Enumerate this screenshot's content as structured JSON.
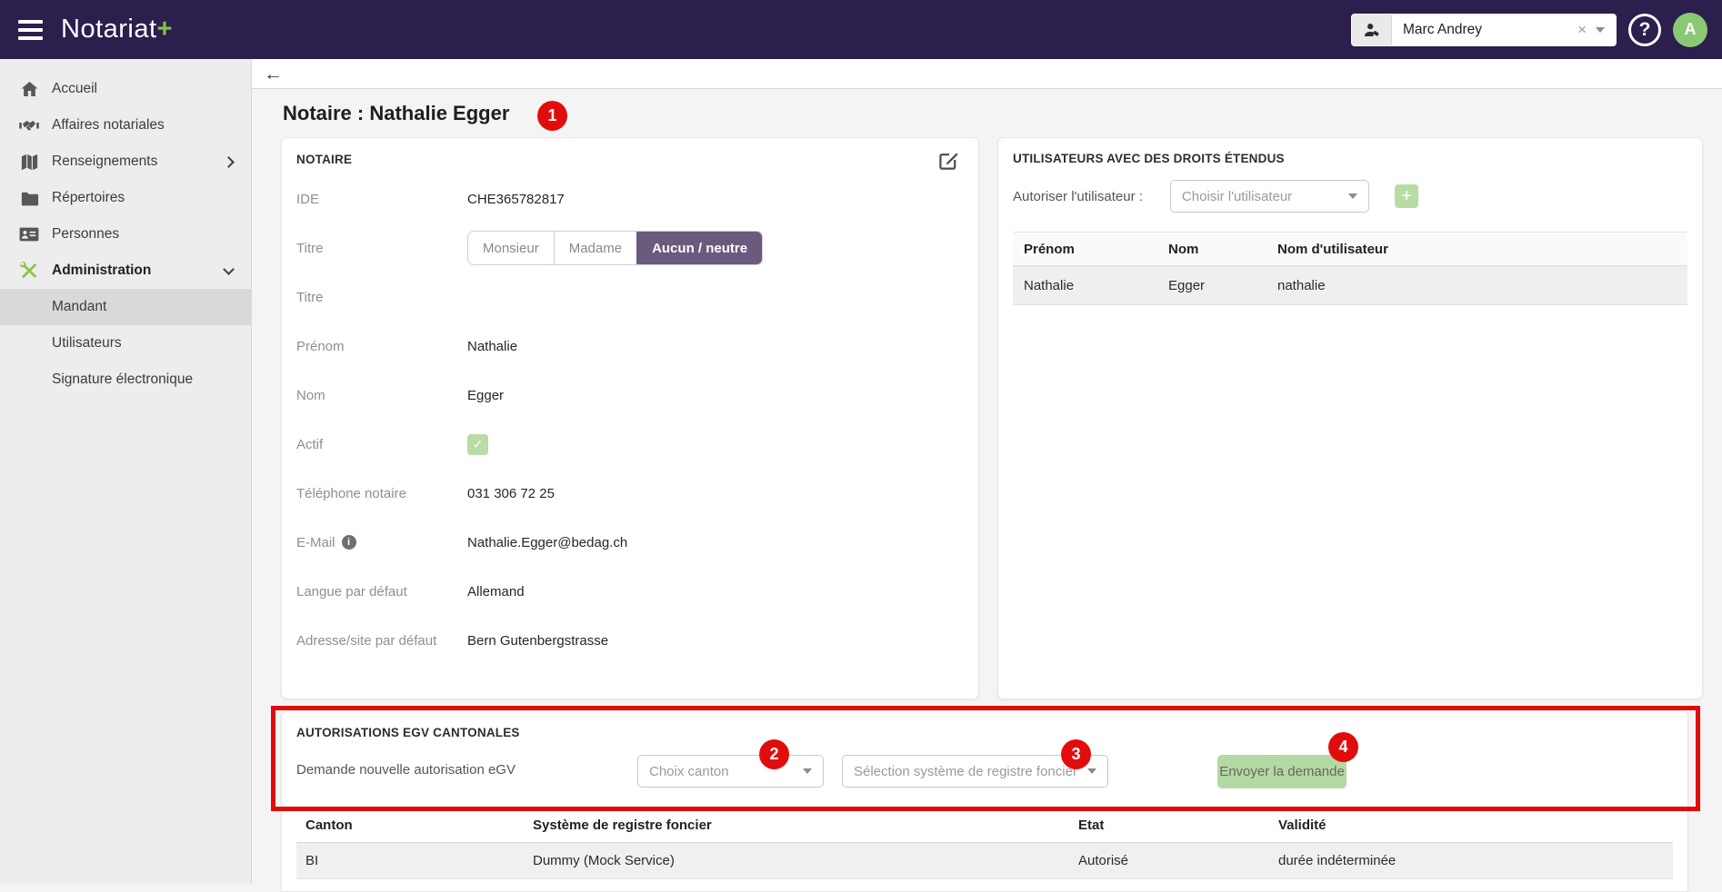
{
  "topbar": {
    "app_title": "Notariat",
    "app_title_plus": "+",
    "user_select": {
      "value": "Marc Andrey",
      "clear_glyph": "×"
    },
    "avatar_initial": "A",
    "help_glyph": "?"
  },
  "sidebar": {
    "items": [
      {
        "label": "Accueil",
        "icon": "home"
      },
      {
        "label": "Affaires notariales",
        "icon": "handshake"
      },
      {
        "label": "Renseignements",
        "icon": "map",
        "chevron": "right"
      },
      {
        "label": "Répertoires",
        "icon": "folder"
      },
      {
        "label": "Personnes",
        "icon": "contact-card"
      },
      {
        "label": "Administration",
        "icon": "tools",
        "chevron": "down",
        "bold": true
      },
      {
        "label": "Mandant",
        "sub": true,
        "active": true
      },
      {
        "label": "Utilisateurs",
        "sub": true
      },
      {
        "label": "Signature électronique",
        "sub": true
      }
    ]
  },
  "page": {
    "back_glyph": "←",
    "title": "Notaire : Nathalie Egger"
  },
  "notaire_card": {
    "title": "NOTAIRE",
    "titre_options": [
      "Monsieur",
      "Madame",
      "Aucun / neutre"
    ],
    "titre_selected": "Aucun / neutre",
    "checkbox_glyph": "✓",
    "info_glyph": "i",
    "fields": [
      {
        "label": "IDE",
        "value": "CHE365782817",
        "type": "text"
      },
      {
        "label": "Titre",
        "type": "segmented"
      },
      {
        "label": "Titre",
        "value": "",
        "type": "text"
      },
      {
        "label": "Prénom",
        "value": "Nathalie",
        "type": "text"
      },
      {
        "label": "Nom",
        "value": "Egger",
        "type": "text"
      },
      {
        "label": "Actif",
        "type": "checkbox",
        "checked": true
      },
      {
        "label": "Téléphone notaire",
        "value": "031 306 72 25",
        "type": "text"
      },
      {
        "label": "E-Mail",
        "value": "Nathalie.Egger@bedag.ch",
        "type": "text",
        "info": true
      },
      {
        "label": "Langue par défaut",
        "value": "Allemand",
        "type": "text"
      },
      {
        "label": "Adresse/site par défaut",
        "value": "Bern Gutenbergstrasse",
        "type": "text"
      }
    ]
  },
  "users_card": {
    "title": "UTILISATEURS AVEC DES DROITS ÉTENDUS",
    "authorize_label": "Autoriser l'utilisateur :",
    "select_placeholder": "Choisir l'utilisateur",
    "add_button_glyph": "+",
    "table": {
      "headers": [
        "Prénom",
        "Nom",
        "Nom d'utilisateur"
      ],
      "rows": [
        [
          "Nathalie",
          "Egger",
          "nathalie"
        ]
      ]
    }
  },
  "egv_card": {
    "title": "AUTORISATIONS EGV CANTONALES",
    "request_label": "Demande nouvelle autorisation eGV",
    "canton_placeholder": "Choix canton",
    "system_placeholder": "Sélection système de registre foncier",
    "submit_button": "Envoyer la demande",
    "table": {
      "headers": [
        "Canton",
        "Système de registre foncier",
        "Etat",
        "Validité"
      ],
      "rows": [
        [
          "BI",
          "Dummy (Mock Service)",
          "Autorisé",
          "durée indéterminée"
        ]
      ]
    }
  },
  "annotations": {
    "badges": [
      "1",
      "2",
      "3",
      "4"
    ]
  },
  "colors": {
    "topbar_purple": "#2c1e4d",
    "accent_green": "#82c341",
    "avatar_green": "#8bc873",
    "button_green": "#b5d9a2",
    "segmented_selected_purple": "#695a7e",
    "annotation_red": "#e10d0d"
  }
}
